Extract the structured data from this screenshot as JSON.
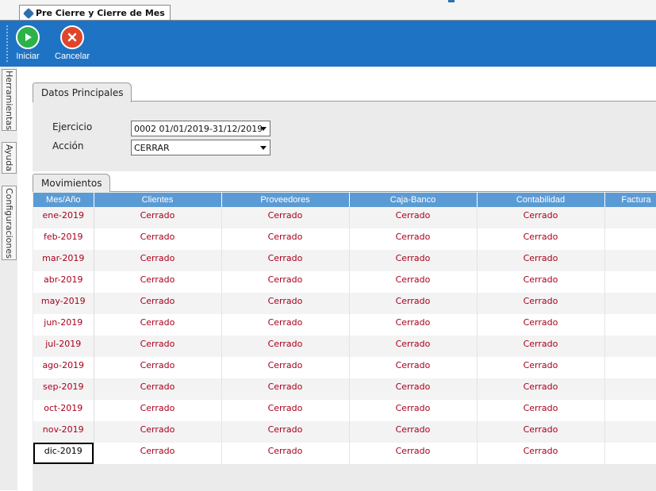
{
  "window": {
    "tab_title": "Pre Cierre y Cierre de Mes"
  },
  "toolbar": {
    "start_label": "Iniciar",
    "cancel_label": "Cancelar"
  },
  "sidebar": {
    "tabs": [
      "Herramientas",
      "Ayuda",
      "Configuraciones"
    ]
  },
  "datos_principales": {
    "tab_label": "Datos Principales",
    "ejercicio_label": "Ejercicio",
    "ejercicio_value": "0002 01/01/2019-31/12/2019",
    "accion_label": "Acción",
    "accion_value": "CERRAR"
  },
  "movimientos": {
    "tab_label": "Movimientos",
    "columns": [
      "Mes/Año",
      "Clientes",
      "Proveedores",
      "Caja-Banco",
      "Contabilidad",
      "Factura"
    ],
    "rows": [
      [
        "ene-2019",
        "Cerrado",
        "Cerrado",
        "Cerrado",
        "Cerrado",
        ""
      ],
      [
        "feb-2019",
        "Cerrado",
        "Cerrado",
        "Cerrado",
        "Cerrado",
        ""
      ],
      [
        "mar-2019",
        "Cerrado",
        "Cerrado",
        "Cerrado",
        "Cerrado",
        ""
      ],
      [
        "abr-2019",
        "Cerrado",
        "Cerrado",
        "Cerrado",
        "Cerrado",
        ""
      ],
      [
        "may-2019",
        "Cerrado",
        "Cerrado",
        "Cerrado",
        "Cerrado",
        ""
      ],
      [
        "jun-2019",
        "Cerrado",
        "Cerrado",
        "Cerrado",
        "Cerrado",
        ""
      ],
      [
        "jul-2019",
        "Cerrado",
        "Cerrado",
        "Cerrado",
        "Cerrado",
        ""
      ],
      [
        "ago-2019",
        "Cerrado",
        "Cerrado",
        "Cerrado",
        "Cerrado",
        ""
      ],
      [
        "sep-2019",
        "Cerrado",
        "Cerrado",
        "Cerrado",
        "Cerrado",
        ""
      ],
      [
        "oct-2019",
        "Cerrado",
        "Cerrado",
        "Cerrado",
        "Cerrado",
        ""
      ],
      [
        "nov-2019",
        "Cerrado",
        "Cerrado",
        "Cerrado",
        "Cerrado",
        ""
      ],
      [
        "dic-2019",
        "Cerrado",
        "Cerrado",
        "Cerrado",
        "Cerrado",
        ""
      ]
    ],
    "selected_row": 11
  },
  "colors": {
    "toolbar_bg": "#1f73c4",
    "header_bg": "#5b9bd5",
    "status_text": "#a8001c"
  },
  "icons": {
    "start": "play-icon",
    "cancel": "close-icon",
    "tab": "window-icon"
  }
}
